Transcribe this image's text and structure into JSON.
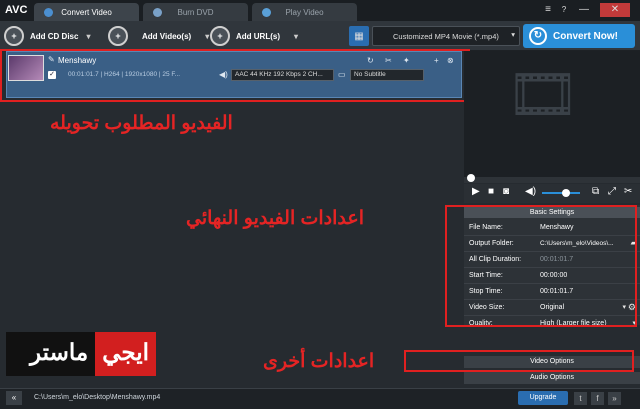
{
  "app": {
    "logo": "AVC"
  },
  "tabs": [
    {
      "label": "Convert Video"
    },
    {
      "label": "Burn DVD"
    },
    {
      "label": "Play Video"
    }
  ],
  "window": {
    "minimize": "—",
    "close": "✕",
    "menu": "≡"
  },
  "toolbar": {
    "add_cd": "Add CD Disc",
    "add_video": "Add Video(s)",
    "add_url": "Add URL(s)",
    "profile": "Customized MP4 Movie (*.mp4)",
    "convert": "Convert Now!"
  },
  "item": {
    "name": "Menshawy",
    "duration": "00:01:01.7",
    "codec": "H264",
    "resolution": "1920x1080",
    "fps": "25 F...",
    "audio": "AAC 44 KHz 192 Kbps 2 CH...",
    "subtitle": "No Subtitle"
  },
  "annotations": {
    "video": "الفيديو المطلوب تحويله",
    "settings": "اعدادات الفيديو النهائي",
    "other": "اعدادات أخرى",
    "brand_a": "ايجي",
    "brand_b": "ماستر"
  },
  "settings": {
    "header": "Basic Settings",
    "rows": [
      {
        "k": "File Name:",
        "v": "Menshawy"
      },
      {
        "k": "Output Folder:",
        "v": "C:\\Users\\m_elo\\Videos\\..."
      },
      {
        "k": "All Clip Duration:",
        "v": "00:01:01.7"
      },
      {
        "k": "Start Time:",
        "v": "00:00:00"
      },
      {
        "k": "Stop Time:",
        "v": "00:01:01.7"
      },
      {
        "k": "Video Size:",
        "v": "Original"
      },
      {
        "k": "Quality:",
        "v": "High (Larger file size)"
      }
    ]
  },
  "options": {
    "video": "Video Options",
    "audio": "Audio Options"
  },
  "bottom": {
    "path": "C:\\Users\\m_elo\\Desktop\\Menshawy.mp4",
    "upgrade": "Upgrade"
  },
  "colors": {
    "accent": "#2a8fd8",
    "annotation": "#e52424",
    "item": "#3a5f86"
  }
}
